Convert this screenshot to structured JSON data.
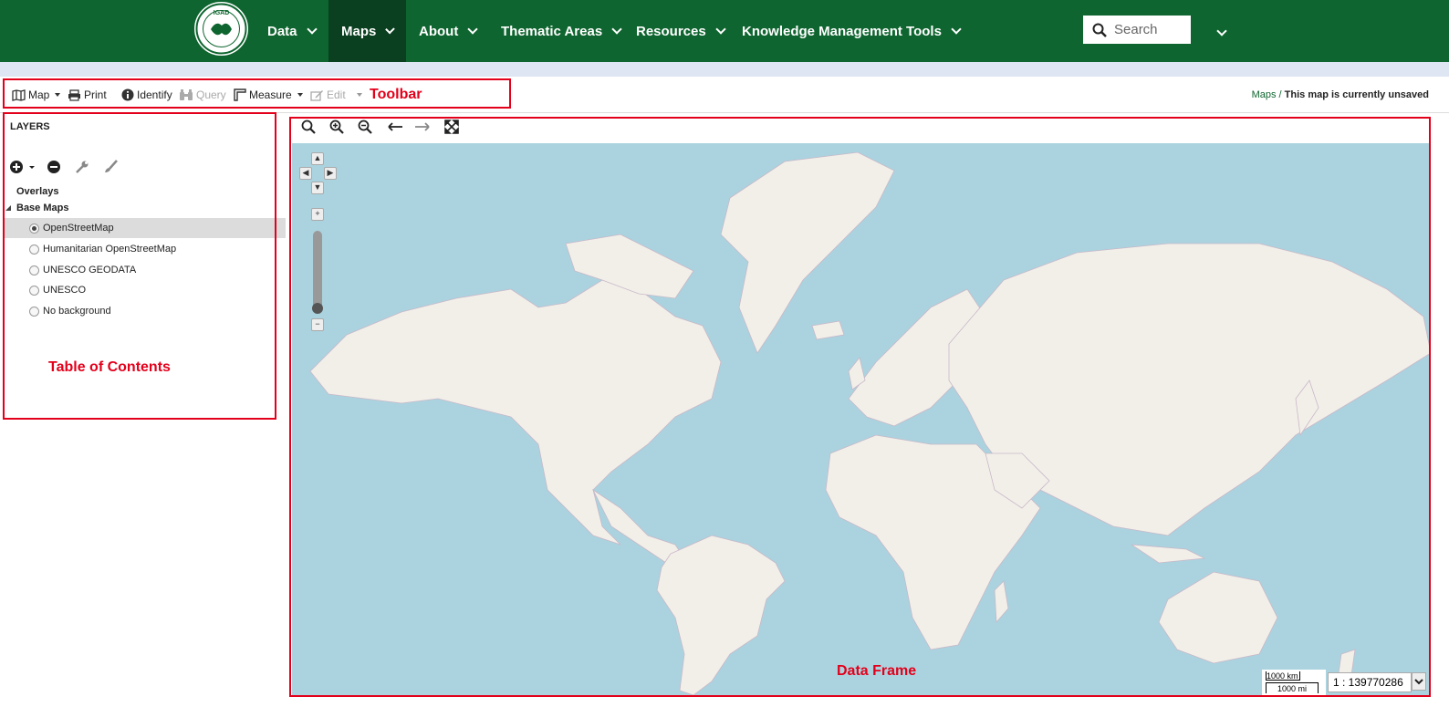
{
  "nav": {
    "items": [
      {
        "label": "Data",
        "active": false
      },
      {
        "label": "Maps",
        "active": true
      },
      {
        "label": "About",
        "active": false
      },
      {
        "label": "Thematic Areas",
        "active": false
      },
      {
        "label": "Resources",
        "active": false
      },
      {
        "label": "Knowledge Management Tools",
        "active": false
      }
    ],
    "search_placeholder": "Search",
    "logo_text": "IGAD",
    "colors": {
      "bar": "#0e652f",
      "active": "#0a3f1f"
    }
  },
  "toolbar": {
    "map_label": "Map",
    "print_label": "Print",
    "identify_label": "Identify",
    "query_label": "Query",
    "measure_label": "Measure",
    "edit_label": "Edit"
  },
  "breadcrumb": {
    "link": "Maps",
    "separator": " / ",
    "status": "This map is currently unsaved"
  },
  "layers": {
    "title": "LAYERS",
    "groups": {
      "overlays": "Overlays",
      "base_maps": "Base Maps"
    },
    "base_maps": [
      {
        "label": "OpenStreetMap",
        "selected": true
      },
      {
        "label": "Humanitarian OpenStreetMap",
        "selected": false
      },
      {
        "label": "UNESCO GEODATA",
        "selected": false
      },
      {
        "label": "UNESCO",
        "selected": false
      },
      {
        "label": "No background",
        "selected": false
      }
    ]
  },
  "annotations": {
    "toolbar": "Toolbar",
    "toc": "Table of Contents",
    "data_frame": "Data Frame",
    "color": "#e3001b"
  },
  "map": {
    "ocean_color": "#aad3df",
    "land_color": "#f2efe9",
    "scale_km": "1000 km",
    "scale_mi": "1000 mi",
    "scale_ratio": "1 : 139770286"
  }
}
